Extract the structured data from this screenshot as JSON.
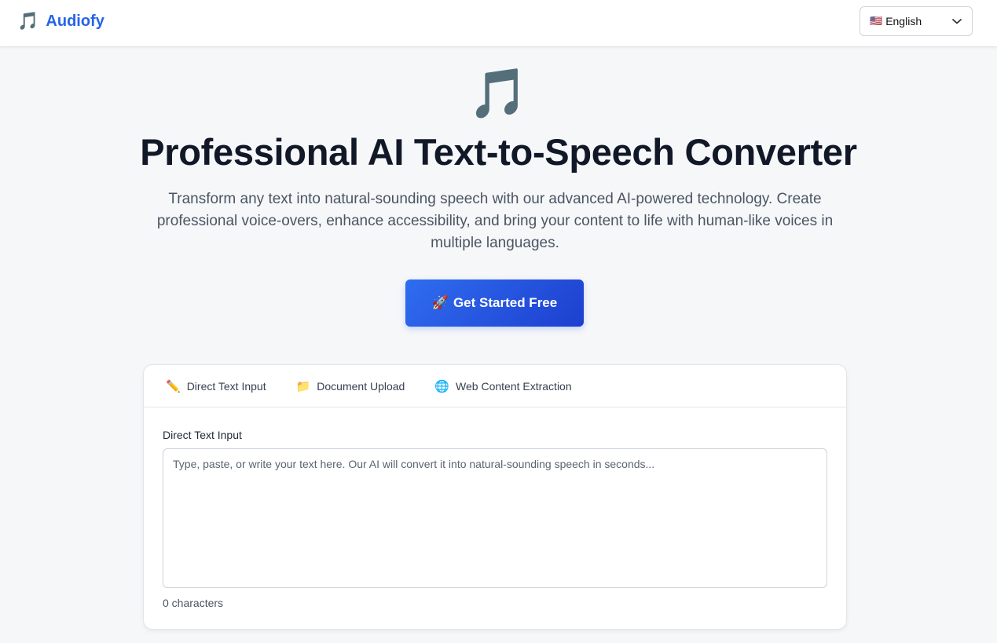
{
  "header": {
    "brand_icon": "music-notes-icon",
    "brand_icon_glyph": "🎵",
    "brand_name": "Audiofy",
    "brand_color": "#2563eb",
    "language": {
      "flag_glyph": "🇺🇸",
      "selected": "English"
    }
  },
  "hero": {
    "icon": "music-notes-icon",
    "icon_glyph": "🎵",
    "title": "Professional AI Text-to-Speech Converter",
    "subtitle": "Transform any text into natural-sounding speech with our advanced AI-powered technology. Create professional voice-overs, enhance accessibility, and bring your content to life with human-like voices in multiple languages.",
    "cta": {
      "icon_glyph": "🚀",
      "label": "Get Started Free"
    }
  },
  "converter": {
    "tabs": [
      {
        "icon": "pencil-icon",
        "icon_glyph": "✏️",
        "label": "Direct Text Input"
      },
      {
        "icon": "folder-icon",
        "icon_glyph": "📁",
        "label": "Document Upload"
      },
      {
        "icon": "globe-icon",
        "icon_glyph": "🌐",
        "label": "Web Content Extraction"
      }
    ],
    "field_label": "Direct Text Input",
    "textarea_placeholder": "Type, paste, or write your text here. Our AI will convert it into natural-sounding speech in seconds...",
    "char_count": "0 characters"
  }
}
